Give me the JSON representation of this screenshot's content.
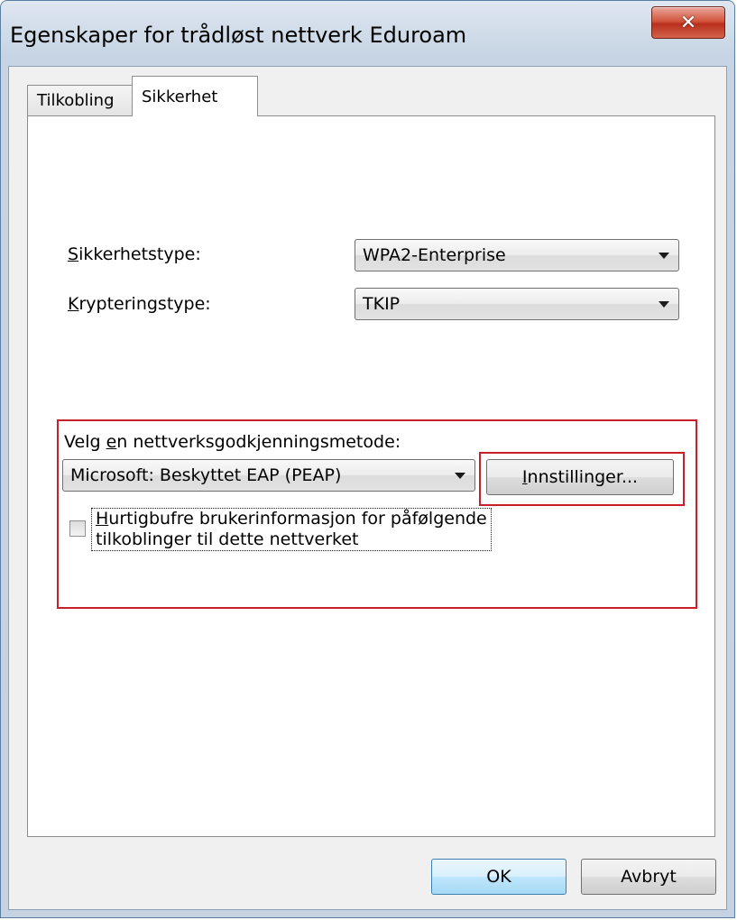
{
  "window": {
    "title": "Egenskaper for trådløst nettverk Eduroam"
  },
  "tabs": [
    {
      "label": "Tilkobling",
      "selected": false
    },
    {
      "label": "Sikkerhet",
      "selected": true
    }
  ],
  "security": {
    "type_label_first": "S",
    "type_label_rest": "ikkerhetstype:",
    "type_value": "WPA2-Enterprise",
    "encryption_label_first": "K",
    "encryption_label_rest": "rypteringstype:",
    "encryption_value": "TKIP"
  },
  "auth": {
    "method_label_pre": "Velg ",
    "method_label_accel": "e",
    "method_label_post": "n nettverksgodkjenningsmetode:",
    "method_value": "Microsoft: Beskyttet EAP (PEAP)",
    "settings_accel": "I",
    "settings_rest": "nnstillinger...",
    "cache_accel": "H",
    "cache_line1_rest": "urtigbufre brukerinformasjon for påfølgende",
    "cache_line2": "tilkoblinger til dette nettverket",
    "cache_checked": false
  },
  "buttons": {
    "ok": "OK",
    "cancel": "Avbryt"
  },
  "colors": {
    "highlight_box": "#c8202a",
    "close_button": "#d3563e"
  },
  "icons": {
    "close": "✕"
  }
}
